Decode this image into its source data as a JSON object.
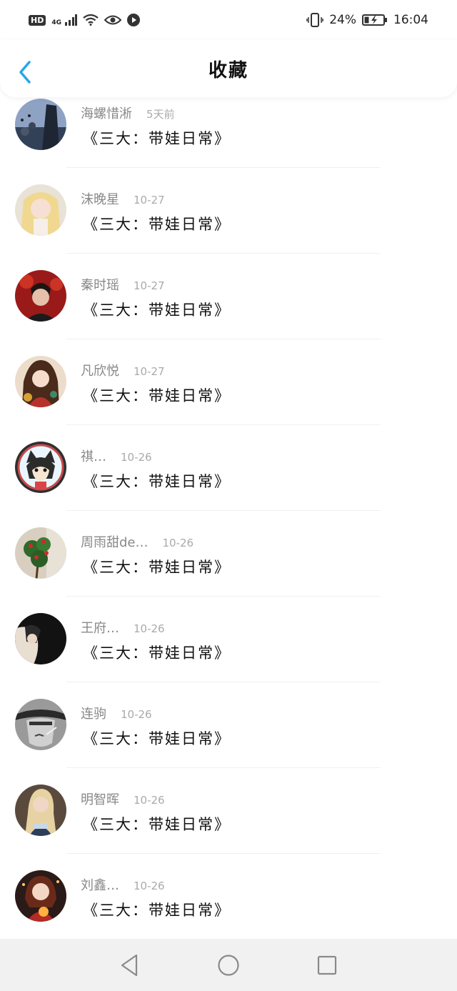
{
  "status_bar": {
    "hd": "HD",
    "network": "4G",
    "vibrate_icon": "vibrate-icon",
    "battery_percent": "24%",
    "time": "16:04"
  },
  "header": {
    "title": "收藏",
    "back_icon": "chevron-left-icon",
    "accent_color": "#2aa7e8"
  },
  "favorites": [
    {
      "name": "海螺惜淅",
      "time": "5天前",
      "work": "《三大：带娃日常》"
    },
    {
      "name": "沫晚星",
      "time": "10-27",
      "work": "《三大：带娃日常》"
    },
    {
      "name": "秦时瑶",
      "time": "10-27",
      "work": "《三大：带娃日常》"
    },
    {
      "name": "凡欣悦",
      "time": "10-27",
      "work": "《三大：带娃日常》"
    },
    {
      "name": "祺…",
      "time": "10-26",
      "work": "《三大：带娃日常》"
    },
    {
      "name": "周雨甜de…",
      "time": "10-26",
      "work": "《三大：带娃日常》"
    },
    {
      "name": "王府…",
      "time": "10-26",
      "work": "《三大：带娃日常》"
    },
    {
      "name": "连驹",
      "time": "10-26",
      "work": "《三大：带娃日常》"
    },
    {
      "name": "明智晖",
      "time": "10-26",
      "work": "《三大：带娃日常》"
    },
    {
      "name": "刘鑫…",
      "time": "10-26",
      "work": "《三大：带娃日常》"
    }
  ],
  "nav_bar": {
    "back_icon": "triangle-back-icon",
    "home_icon": "circle-home-icon",
    "recents_icon": "square-recents-icon"
  }
}
